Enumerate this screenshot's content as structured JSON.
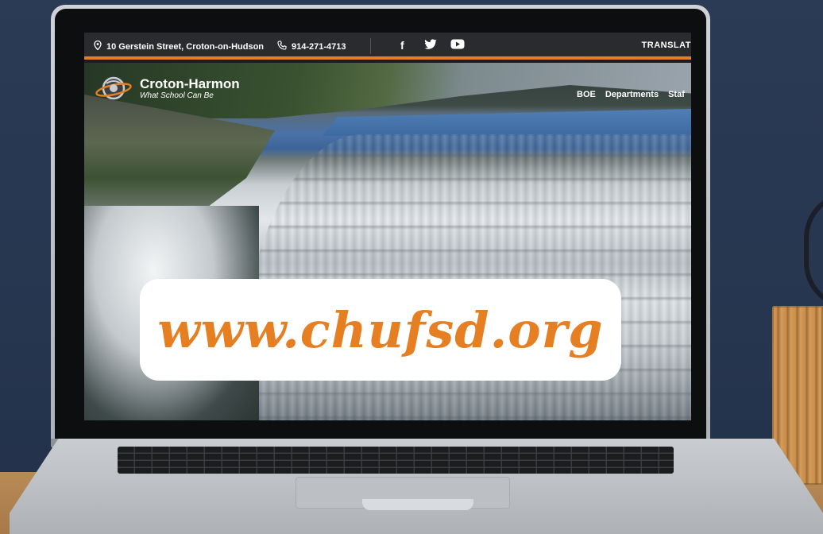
{
  "topbar": {
    "address": "10 Gerstein Street, Croton-on-Hudson",
    "phone": "914-271-4713",
    "social_facebook": "f",
    "translate": "TRANSLAT"
  },
  "site": {
    "name": "Croton-Harmon",
    "tagline": "What School Can Be"
  },
  "nav": {
    "items": [
      "BOE",
      "Departments",
      "Staf"
    ]
  },
  "banner": {
    "url": "www.chufsd.org"
  },
  "colors": {
    "accent": "#e67e22",
    "topbar_bg": "#2a2b2e"
  }
}
